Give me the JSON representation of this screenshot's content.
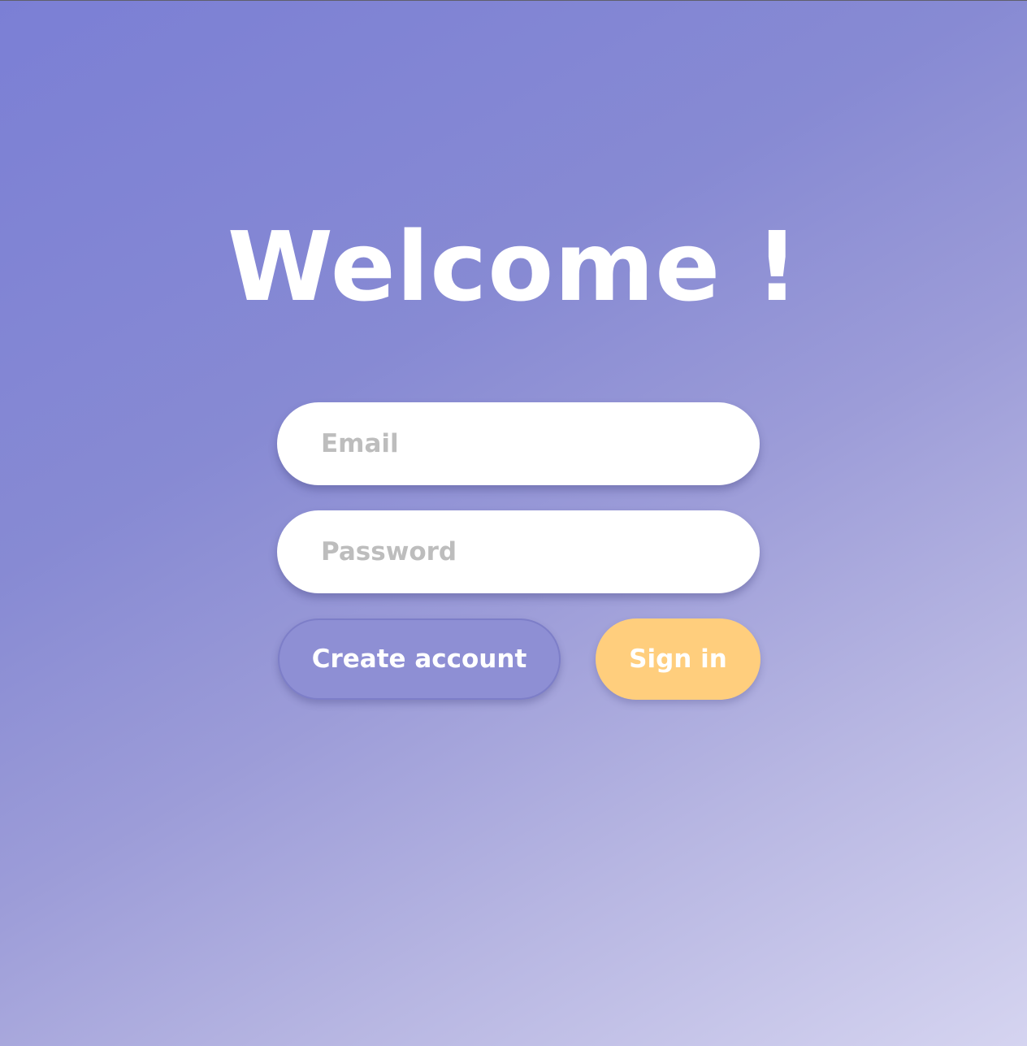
{
  "login": {
    "title": "Welcome !",
    "email": {
      "placeholder": "Email",
      "value": ""
    },
    "password": {
      "placeholder": "Password",
      "value": ""
    },
    "create_account_label": "Create account",
    "sign_in_label": "Sign in"
  },
  "colors": {
    "background_start": "#7b7fd5",
    "background_end": "#d5d4f0",
    "sign_in_button": "#ffce7d",
    "create_account_button": "#8e8fd4",
    "text": "#ffffff",
    "placeholder": "#bdbdbd"
  }
}
